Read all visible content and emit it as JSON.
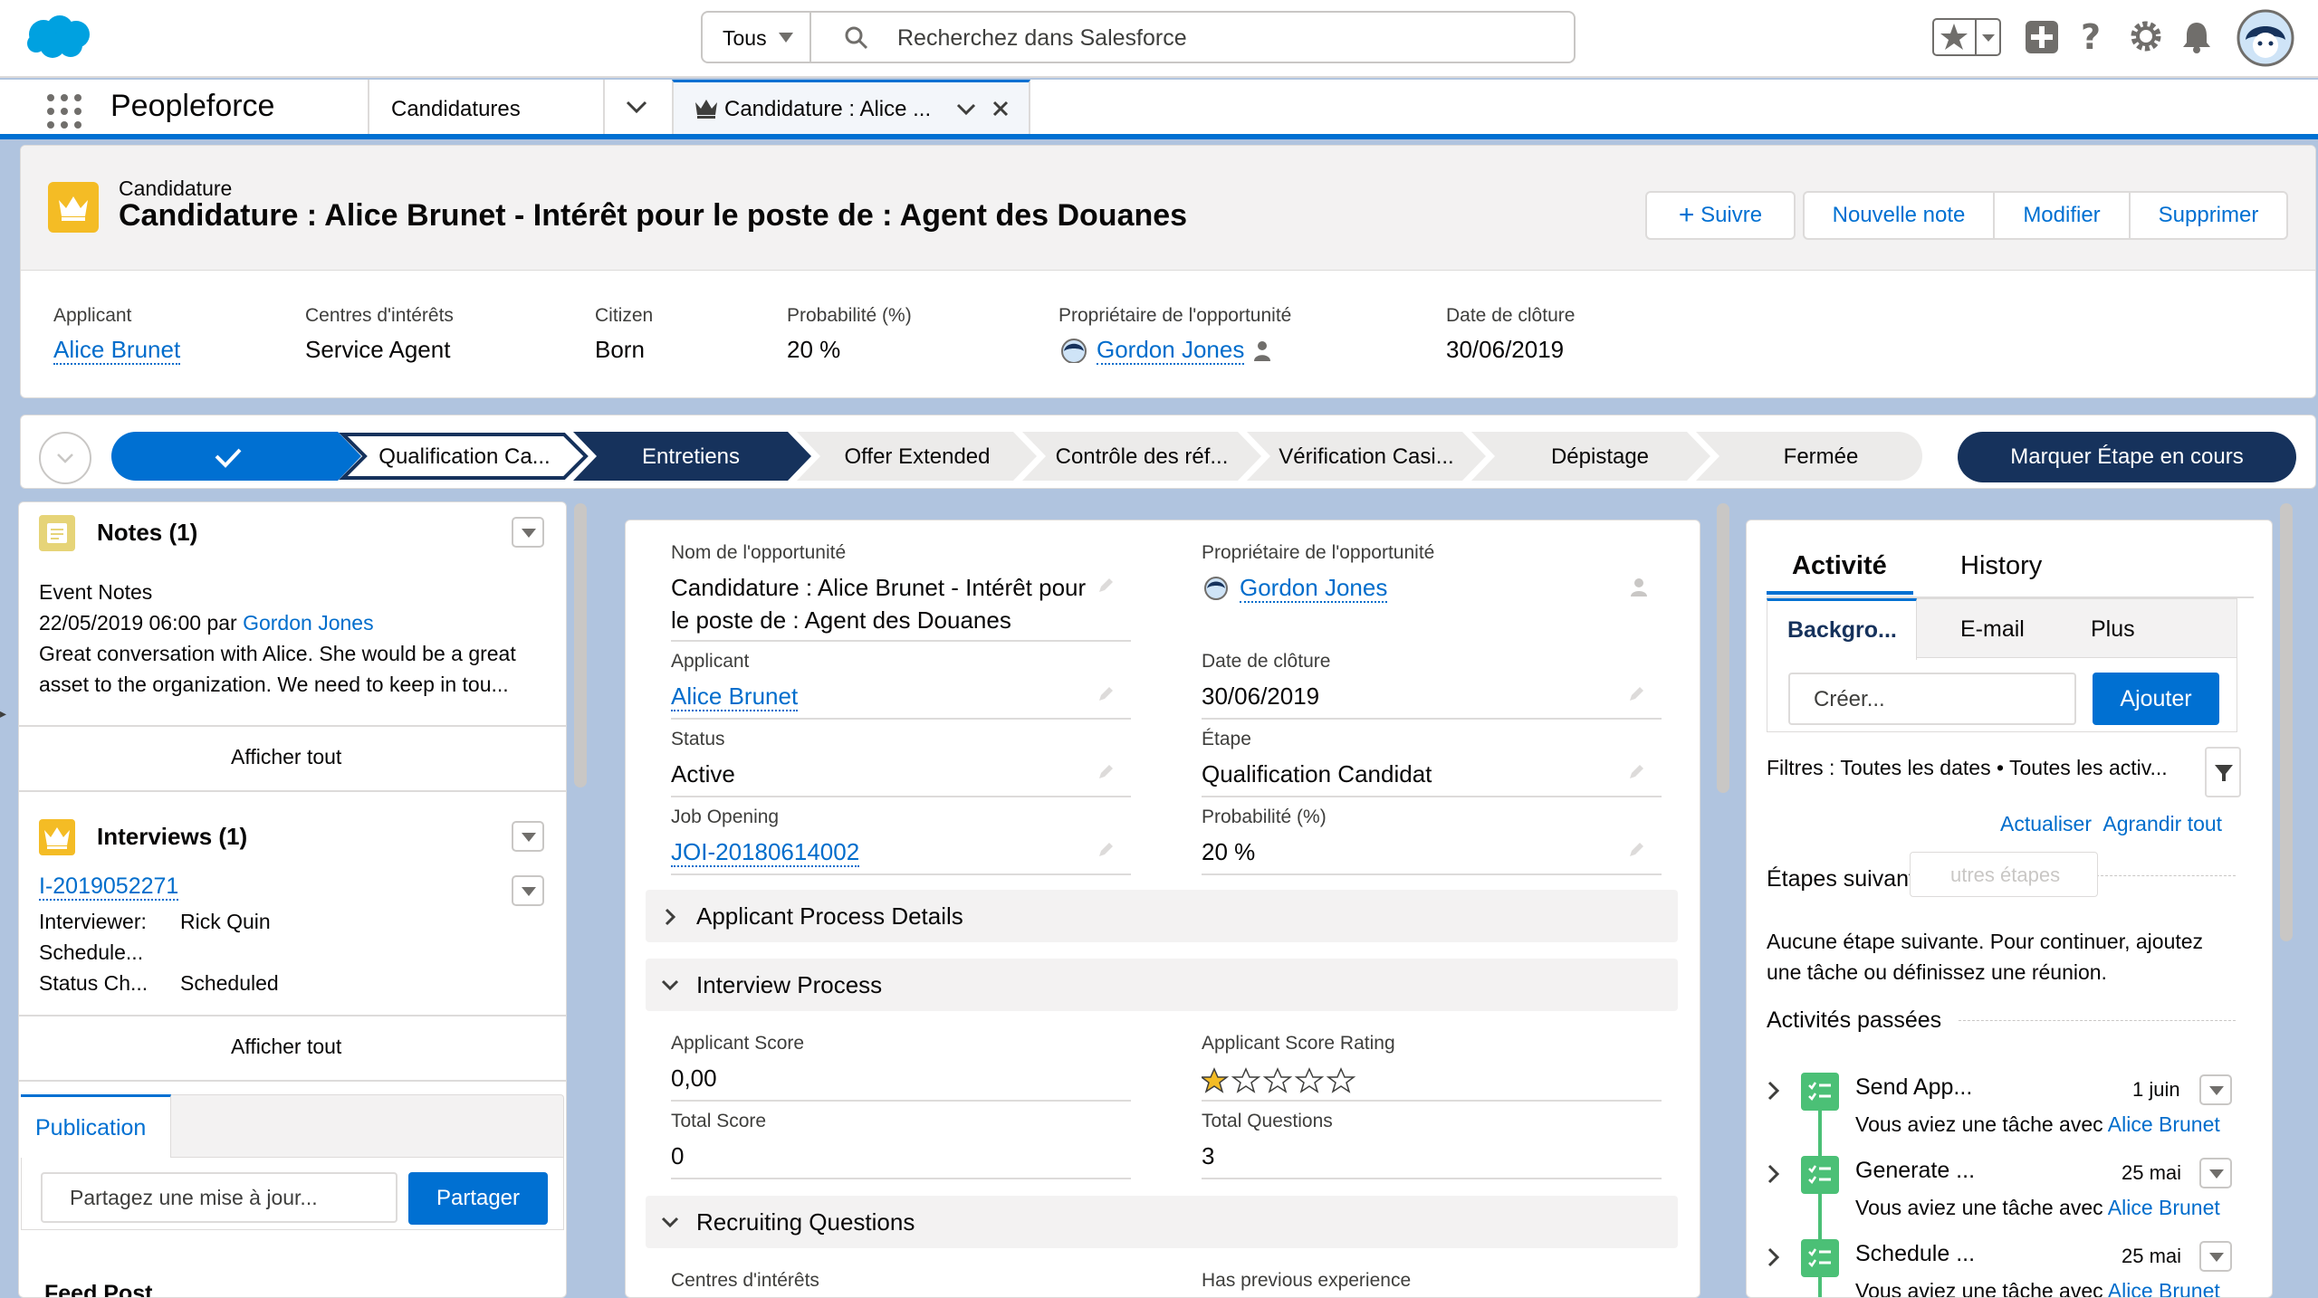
{
  "header": {
    "search_scope": "Tous",
    "search_placeholder": "Recherchez dans Salesforce"
  },
  "nav": {
    "app_name": "Peopleforce",
    "tab_object": "Candidatures",
    "tab_active": "Candidature : Alice ..."
  },
  "record": {
    "object_label": "Candidature",
    "title": "Candidature : Alice Brunet - Intérêt pour le poste de : Agent des Douanes",
    "buttons": {
      "follow": "Suivre",
      "new_note": "Nouvelle note",
      "edit": "Modifier",
      "delete": "Supprimer"
    },
    "highlights": [
      {
        "label": "Applicant",
        "value": "Alice Brunet"
      },
      {
        "label": "Centres d'intérêts",
        "value": "Service Agent"
      },
      {
        "label": "Citizen",
        "value": "Born"
      },
      {
        "label": "Probabilité (%)",
        "value": "20 %"
      },
      {
        "label": "Propriétaire de l'opportunité",
        "value": "Gordon Jones"
      },
      {
        "label": "Date de clôture",
        "value": "30/06/2019"
      }
    ]
  },
  "path": {
    "stages": [
      "Qualification Ca...",
      "Entretiens",
      "Offer Extended",
      "Contrôle des réf...",
      "Vérification Casi...",
      "Dépistage",
      "Fermée"
    ],
    "mark_button": "Marquer Étape en cours"
  },
  "notes": {
    "title": "Notes (1)",
    "item_title": "Event Notes",
    "item_meta": "22/05/2019 06:00 par",
    "item_author": "Gordon Jones",
    "item_body_1": "Great conversation with Alice. She would be a great",
    "item_body_2": "asset to the organization. We need to keep in tou...",
    "view_all": "Afficher tout"
  },
  "interviews": {
    "title": "Interviews (1)",
    "item_id": "I-2019052271",
    "interviewer_label": "Interviewer:",
    "interviewer": "Rick Quin",
    "schedule_label": "Schedule...",
    "status_label": "Status Ch...",
    "status_value": "Scheduled",
    "view_all": "Afficher tout"
  },
  "publisher": {
    "tab": "Publication",
    "placeholder": "Partagez une mise à jour...",
    "share": "Partager",
    "feed_label": "Feed Post"
  },
  "details": {
    "fields": {
      "opp_name_label": "Nom de l'opportunité",
      "opp_name_1": "Candidature : Alice Brunet - Intérêt pour",
      "opp_name_2": "le poste de : Agent des Douanes",
      "owner_label": "Propriétaire de l'opportunité",
      "owner": "Gordon Jones",
      "applicant_label": "Applicant",
      "applicant": "Alice Brunet",
      "close_label": "Date de clôture",
      "close": "30/06/2019",
      "status_label": "Status",
      "status": "Active",
      "stage_label": "Étape",
      "stage": "Qualification Candidat",
      "job_label": "Job Opening",
      "job": "JOI-20180614002",
      "prob_label": "Probabilité (%)",
      "prob": "20 %"
    },
    "sections": {
      "process": "Applicant Process Details",
      "interview": "Interview Process",
      "recruiting": "Recruiting Questions"
    },
    "interview": {
      "score_label": "Applicant Score",
      "score": "0,00",
      "rating_label": "Applicant Score Rating",
      "rating": 1,
      "total_label": "Total Score",
      "total": "0",
      "questions_label": "Total Questions",
      "questions": "3"
    },
    "recruiting": {
      "interests_label": "Centres d'intérêts",
      "experience_label": "Has previous experience"
    }
  },
  "activity": {
    "tab_activity": "Activité",
    "tab_history": "History",
    "sub_tabs": [
      "Backgro...",
      "E-mail",
      "Plus"
    ],
    "create_placeholder": "Créer...",
    "add": "Ajouter",
    "filters": "Filtres : Toutes les dates • Toutes les activ...",
    "refresh": "Actualiser",
    "expand": "Agrandir tout",
    "next_steps": "Étapes suivantes",
    "more_steps": "utres étapes",
    "no_next_1": "Aucune étape suivante. Pour continuer, ajoutez",
    "no_next_2": "une tâche ou définissez une réunion.",
    "past": "Activités passées",
    "items": [
      {
        "title": "Send App...",
        "date": "1 juin",
        "desc": "Vous aviez une tâche avec",
        "who": "Alice Brunet"
      },
      {
        "title": "Generate ...",
        "date": "25 mai",
        "desc": "Vous aviez une tâche avec",
        "who": "Alice Brunet"
      },
      {
        "title": "Schedule ...",
        "date": "25 mai",
        "desc": "Vous aviez une tâche avec",
        "who": "Alice Brunet"
      }
    ]
  },
  "colors": {
    "brand": "#0070d2",
    "navy": "#16325c",
    "accent_yellow": "#f4bc25",
    "task_green": "#4bc076"
  }
}
